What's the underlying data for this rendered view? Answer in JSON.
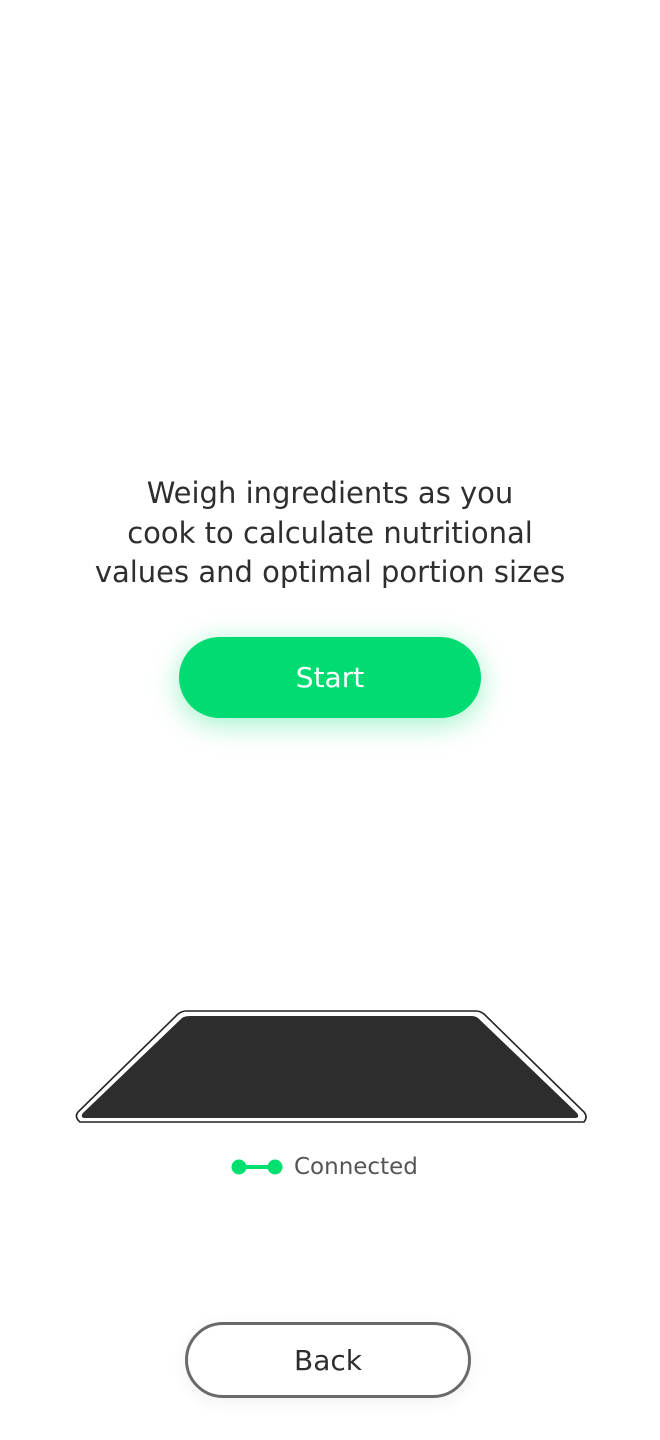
{
  "intro": {
    "lines": [
      "Weigh ingredients as you",
      "cook to calculate nutritional",
      "values and optimal portion sizes"
    ]
  },
  "buttons": {
    "start_label": "Start",
    "back_label": "Back"
  },
  "scale_status": {
    "label": "Connected",
    "icon": "connected-link-icon"
  },
  "colors": {
    "accent": "#00dc72",
    "scale_top": "#2d2d2d",
    "text": "#2e2e2e",
    "back_border": "#6a6a6a"
  }
}
